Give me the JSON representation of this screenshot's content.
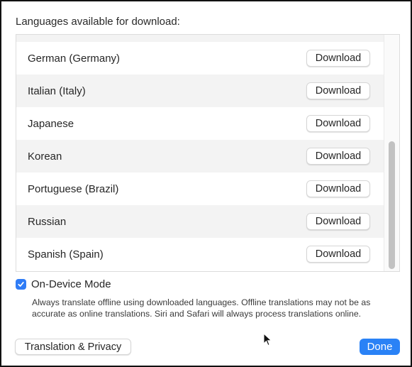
{
  "heading": "Languages available for download:",
  "languages": [
    {
      "name": "German (Germany)",
      "action": "Download"
    },
    {
      "name": "Italian (Italy)",
      "action": "Download"
    },
    {
      "name": "Japanese",
      "action": "Download"
    },
    {
      "name": "Korean",
      "action": "Download"
    },
    {
      "name": "Portuguese (Brazil)",
      "action": "Download"
    },
    {
      "name": "Russian",
      "action": "Download"
    },
    {
      "name": "Spanish (Spain)",
      "action": "Download"
    }
  ],
  "on_device": {
    "label": "On-Device Mode",
    "checked": true,
    "description": "Always translate offline using downloaded languages. Offline translations may not be as accurate as online translations. Siri and Safari will always process translations online."
  },
  "footer": {
    "privacy_label": "Translation & Privacy",
    "done_label": "Done"
  },
  "colors": {
    "accent": "#2a82f6"
  }
}
